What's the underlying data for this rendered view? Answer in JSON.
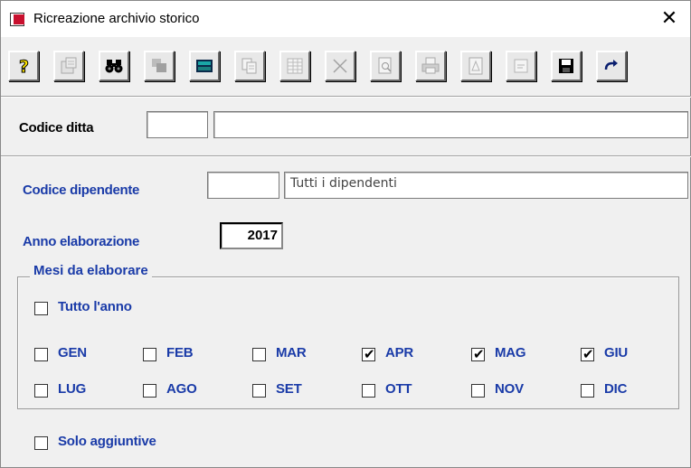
{
  "window": {
    "title": "Ricreazione archivio storico",
    "close_glyph": "✕"
  },
  "toolbar": {
    "buttons": [
      {
        "name": "help-icon",
        "enabled": true
      },
      {
        "name": "properties-icon",
        "enabled": false
      },
      {
        "name": "binoculars-icon",
        "enabled": true
      },
      {
        "name": "windows-icon",
        "enabled": false
      },
      {
        "name": "calculator-icon",
        "enabled": true
      },
      {
        "name": "copy-icon",
        "enabled": false
      },
      {
        "name": "grid-icon",
        "enabled": false
      },
      {
        "name": "delete-icon",
        "enabled": false
      },
      {
        "name": "print-preview-icon",
        "enabled": false
      },
      {
        "name": "printer-icon",
        "enabled": false
      },
      {
        "name": "pdf-icon",
        "enabled": false
      },
      {
        "name": "form-icon",
        "enabled": false
      },
      {
        "name": "save-icon",
        "enabled": true
      },
      {
        "name": "redo-icon",
        "enabled": true
      }
    ]
  },
  "form": {
    "codice_ditta": {
      "label": "Codice ditta",
      "code": "",
      "description": ""
    },
    "codice_dipendente": {
      "label": "Codice dipendente",
      "code": "",
      "description": "Tutti i dipendenti"
    },
    "anno_elaborazione": {
      "label": "Anno elaborazione",
      "value": "2017"
    },
    "mesi": {
      "legend": "Mesi da elaborare",
      "tutto_anno": {
        "label": "Tutto l'anno",
        "checked": false
      },
      "months": [
        {
          "label": "GEN",
          "checked": false
        },
        {
          "label": "FEB",
          "checked": false
        },
        {
          "label": "MAR",
          "checked": false
        },
        {
          "label": "APR",
          "checked": true
        },
        {
          "label": "MAG",
          "checked": true
        },
        {
          "label": "GIU",
          "checked": true
        },
        {
          "label": "LUG",
          "checked": false
        },
        {
          "label": "AGO",
          "checked": false
        },
        {
          "label": "SET",
          "checked": false
        },
        {
          "label": "OTT",
          "checked": false
        },
        {
          "label": "NOV",
          "checked": false
        },
        {
          "label": "DIC",
          "checked": false
        }
      ]
    },
    "solo_aggiuntive": {
      "label": "Solo aggiuntive",
      "checked": false
    }
  },
  "colors": {
    "label_blue": "#1a3ba8",
    "label_black": "#000000"
  }
}
